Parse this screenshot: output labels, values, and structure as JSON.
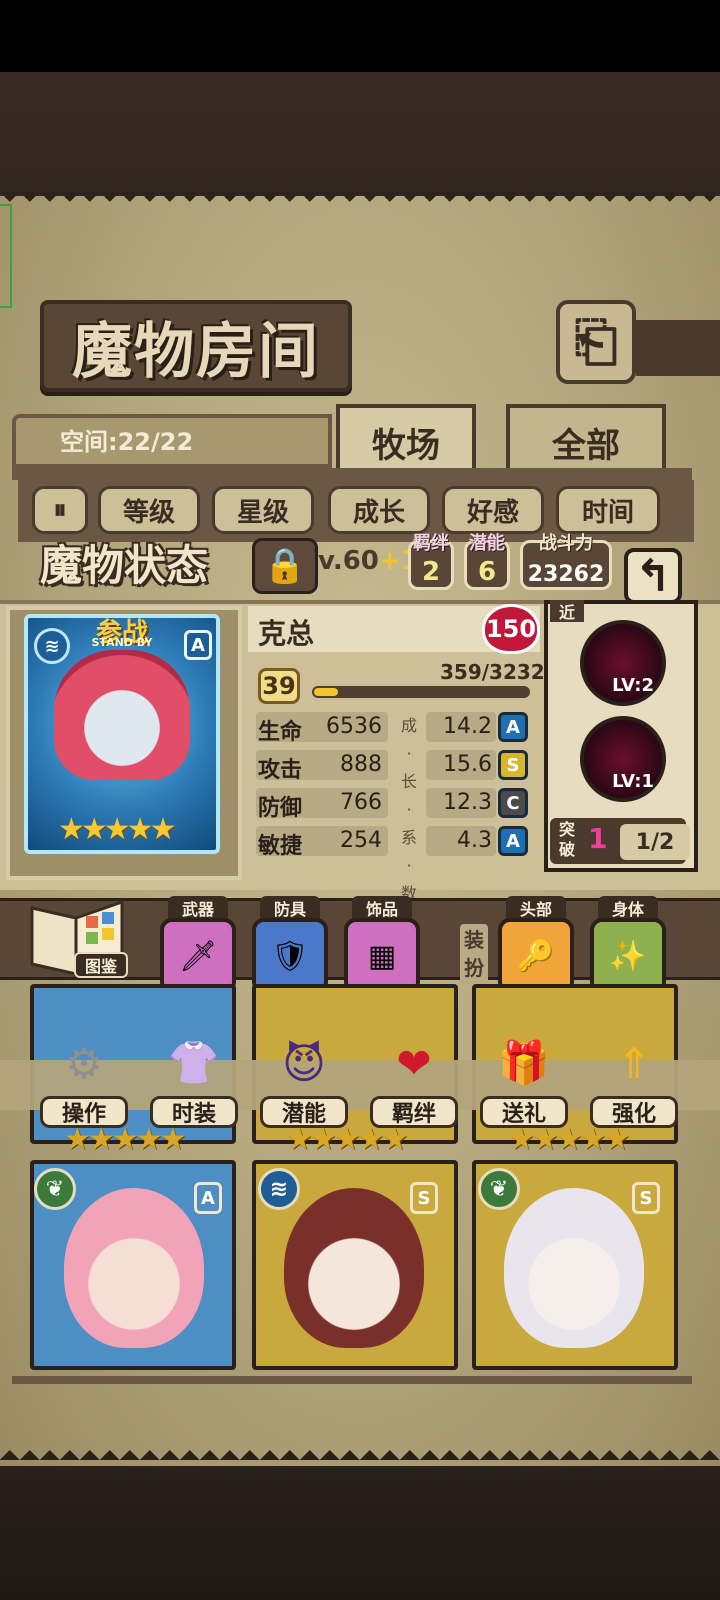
{
  "title": "魔物房间",
  "space_label": "空间:22/22",
  "tabs": [
    "牧场",
    "全部"
  ],
  "sort_buttons": [
    "等级",
    "星级",
    "成长",
    "好感",
    "时间"
  ],
  "status_title": "魔物状态",
  "level_cap": "v.60",
  "level_bonus": "+1",
  "bond": {
    "label": "羁绊",
    "value": "2"
  },
  "potential": {
    "label": "潜能",
    "value": "6"
  },
  "power": {
    "label": "战斗力",
    "value": "23262"
  },
  "monster": {
    "card_title": "参战",
    "card_sub": "STAND BY",
    "rank": "A",
    "name": "克总",
    "affection": "150",
    "level": "39",
    "exp": "359/3232",
    "exp_fraction": 0.111,
    "stars": "★★★★★"
  },
  "stats": [
    {
      "name": "生命",
      "value": "6536",
      "growth": "14.2",
      "grade": "A"
    },
    {
      "name": "攻击",
      "value": "888",
      "growth": "15.6",
      "grade": "S"
    },
    {
      "name": "防御",
      "value": "766",
      "growth": "12.3",
      "grade": "C"
    },
    {
      "name": "敏捷",
      "value": "254",
      "growth": "4.3",
      "grade": "A"
    }
  ],
  "growth_vertical": "成·长·系·数",
  "skills": {
    "range": "近",
    "skill1_level": "LV:2",
    "skill2_level": "LV:1"
  },
  "breakthrough": {
    "label": "突破",
    "value": "1",
    "ratio": "1/2"
  },
  "equipment": {
    "book_label": "图鉴",
    "weapon": "武器",
    "armor": "防具",
    "accessory": "饰品",
    "dress_label": "装扮",
    "head": "头部",
    "body": "身体"
  },
  "actions": [
    "操作",
    "时装",
    "潜能",
    "羁绊",
    "送礼",
    "强化"
  ],
  "colors": {
    "grade_A": "#1f6fb3",
    "grade_S": "#d8b52a",
    "grade_C": "#4b4b4b",
    "affection": "#c2173a",
    "accent_pink": "#f53b9b"
  }
}
